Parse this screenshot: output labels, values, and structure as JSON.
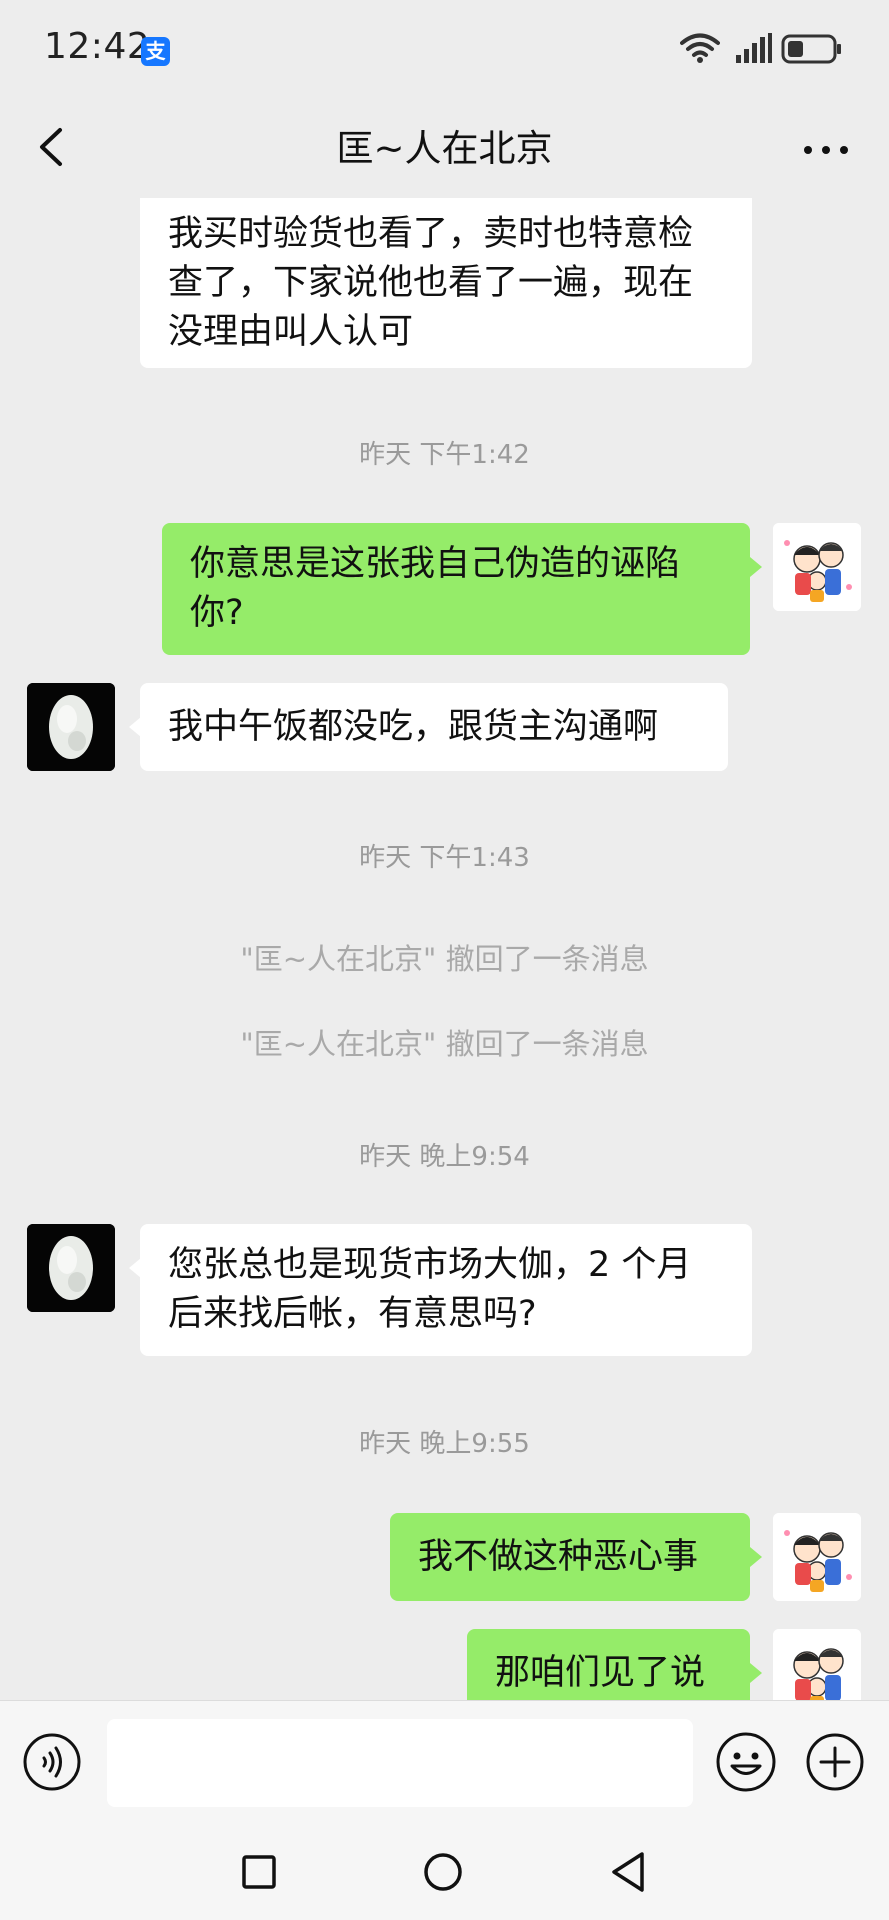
{
  "status_bar": {
    "time": "12:42",
    "app_badge": "支",
    "icons": [
      "alipay-icon",
      "wifi-icon",
      "signal-icon",
      "battery-icon"
    ],
    "battery_level": 0.35
  },
  "header": {
    "title": "匡~人在北京",
    "icons": [
      "back-arrow-icon",
      "more-dots-icon"
    ]
  },
  "messages": [
    {
      "type": "in",
      "text": "我买时验货也看了，卖时也特意检\n查了，下家说他也看了一遍，现在\n没理由叫人认可"
    },
    {
      "type": "timestamp",
      "text": "昨天 下午1:42"
    },
    {
      "type": "out",
      "text": "你意思是这张我自己伪造的诬陷\n你?"
    },
    {
      "type": "in",
      "text": "我中午饭都没吃，跟货主沟通啊"
    },
    {
      "type": "timestamp",
      "text": "昨天 下午1:43"
    },
    {
      "type": "system",
      "text": "\"匡~人在北京\" 撤回了一条消息"
    },
    {
      "type": "system",
      "text": "\"匡~人在北京\" 撤回了一条消息"
    },
    {
      "type": "timestamp",
      "text": "昨天 晚上9:54"
    },
    {
      "type": "in",
      "text": "您张总也是现货市场大伽，2 个月\n后来找后帐，有意思吗?"
    },
    {
      "type": "timestamp",
      "text": "昨天 晚上9:55"
    },
    {
      "type": "out",
      "text": "我不做这种恶心事"
    },
    {
      "type": "out",
      "text": "那咱们见了说"
    }
  ],
  "input_bar": {
    "placeholder": "",
    "icons": [
      "voice-icon",
      "emoji-icon",
      "plus-icon"
    ]
  },
  "nav_bar": {
    "icons": [
      "recent-apps-icon",
      "home-icon",
      "back-icon"
    ]
  },
  "colors": {
    "background": "#ededed",
    "outgoing_bubble": "#95ec69",
    "incoming_bubble": "#ffffff",
    "timestamp_text": "#9a9a9a",
    "alipay_blue": "#1677ff"
  }
}
